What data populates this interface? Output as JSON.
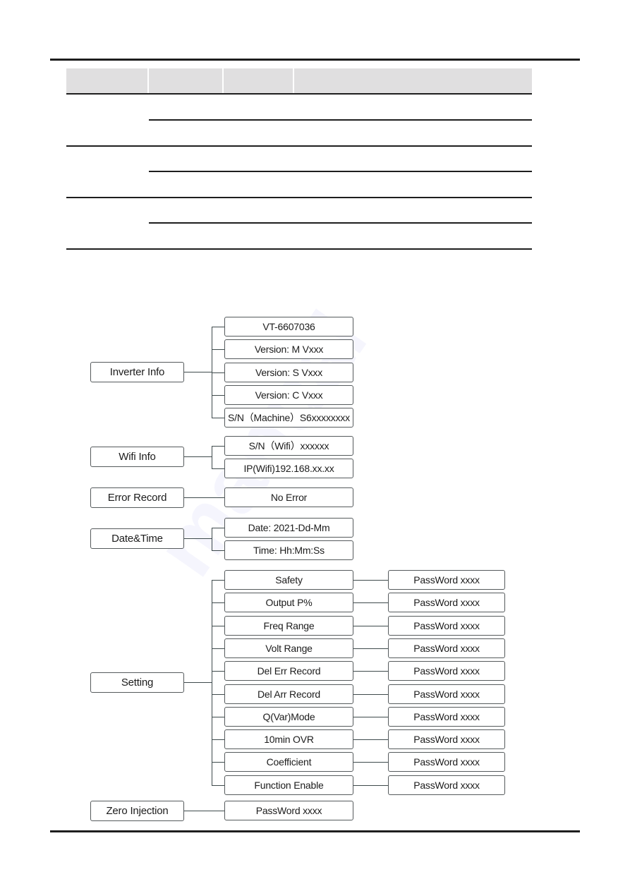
{
  "table": {
    "header_cells": [
      "",
      "",
      "",
      ""
    ],
    "rows": [
      {
        "group": 1,
        "cells": [
          "",
          "",
          "",
          ""
        ]
      },
      {
        "group": 1,
        "cells": [
          "",
          "",
          ""
        ]
      },
      {
        "group": 2,
        "cells": [
          "",
          "",
          "",
          ""
        ]
      },
      {
        "group": 2,
        "cells": [
          "",
          "",
          ""
        ]
      },
      {
        "group": 3,
        "cells": [
          "",
          "",
          "",
          ""
        ]
      },
      {
        "group": 3,
        "cells": [
          "",
          "",
          ""
        ]
      }
    ]
  },
  "menu_tree": [
    {
      "label": "Inverter Info",
      "children": [
        {
          "label": "VT-6607036"
        },
        {
          "label": "Version:  M Vxxx"
        },
        {
          "label": "Version:  S Vxxx"
        },
        {
          "label": "Version:  C Vxxx"
        },
        {
          "label": "S/N（Machine）S6xxxxxxxx"
        }
      ]
    },
    {
      "label": "Wifi Info",
      "children": [
        {
          "label": "S/N（Wifi）xxxxxx"
        },
        {
          "label": "IP(Wifi)192.168.xx.xx"
        }
      ]
    },
    {
      "label": "Error Record",
      "children": [
        {
          "label": "No Error"
        }
      ]
    },
    {
      "label": "Date&Time",
      "children": [
        {
          "label": "Date: 2021-Dd-Mm"
        },
        {
          "label": "Time: Hh:Mm:Ss"
        }
      ]
    },
    {
      "label": "Setting",
      "children": [
        {
          "label": "Safety",
          "password": "PassWord xxxx"
        },
        {
          "label": "Output P%",
          "password": "PassWord xxxx"
        },
        {
          "label": "Freq Range",
          "password": "PassWord xxxx"
        },
        {
          "label": "Volt Range",
          "password": "PassWord xxxx"
        },
        {
          "label": "Del Err Record",
          "password": "PassWord xxxx"
        },
        {
          "label": "Del Arr Record",
          "password": "PassWord xxxx"
        },
        {
          "label": "Q(Var)Mode",
          "password": "PassWord xxxx"
        },
        {
          "label": "10min OVR",
          "password": "PassWord xxxx"
        },
        {
          "label": "Coefficient",
          "password": "PassWord xxxx"
        },
        {
          "label": "Function Enable",
          "password": "PassWord xxxx"
        }
      ]
    },
    {
      "label": "Zero Injection",
      "children": [
        {
          "label": "PassWord xxxx"
        }
      ]
    }
  ]
}
